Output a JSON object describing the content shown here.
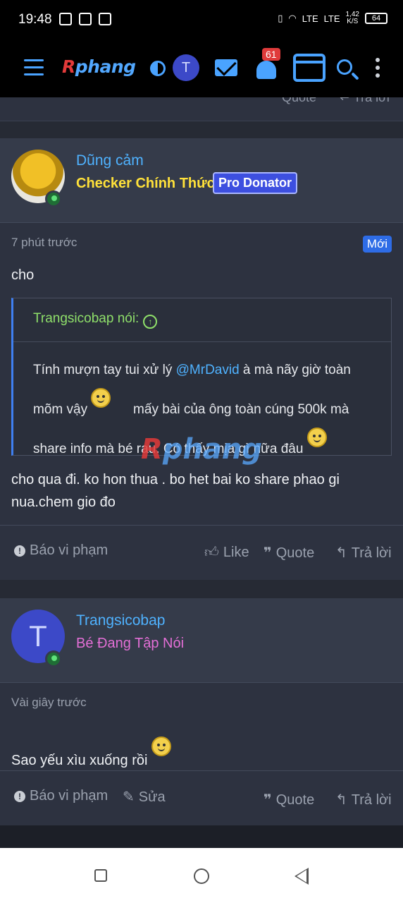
{
  "status_bar": {
    "time": "19:48",
    "network_1": "LTE",
    "network_2": "LTE",
    "speed": "1,42",
    "speed_unit": "K/S",
    "battery": "64"
  },
  "header": {
    "logo_r": "R",
    "logo_rest": "phang",
    "avatar_letter": "T",
    "notification_count": "61"
  },
  "prev_post": {
    "quote_label": "Quote",
    "reply_label": "Trả lời"
  },
  "posts": [
    {
      "username": "Dũng cảm",
      "role": "Checker Chính Thức",
      "badge": "Pro Donator",
      "time": "7 phút trước",
      "new_label": "Mới",
      "text_before": "cho",
      "quote": {
        "author": "Trangsicobap nói:",
        "line1_a": "Tính mượn tay tui xử lý ",
        "mention": "@MrDavid",
        "line1_b": " à mà nãy giờ toàn",
        "line2_a": "mõm vậy",
        "line2_b": "mấy bài của ông toàn cúng 500k mà",
        "line3": "share info mà bé rau. Có thấy mịa gì nữa đâu"
      },
      "watermark_r": "R",
      "watermark_rest": "phang",
      "text_after": "cho qua đi. ko hon thua . bo het bai ko share phao gi nua.chem gio đo",
      "report_label": "Báo vi phạm",
      "like_label": "Like",
      "quote_label": "Quote",
      "reply_label": "Trả lời"
    },
    {
      "username": "Trangsicobap",
      "avatar_letter": "T",
      "role": "Bé Đang Tập Nói",
      "time": "Vài giây trước",
      "text": "Sao yếu xìu xuống rồi",
      "report_label": "Báo vi phạm",
      "edit_label": "Sửa",
      "quote_label": "Quote",
      "reply_label": "Trả lời"
    }
  ],
  "icons": {
    "accent": "#4aa3ff",
    "badge_color": "#e03b3b"
  }
}
